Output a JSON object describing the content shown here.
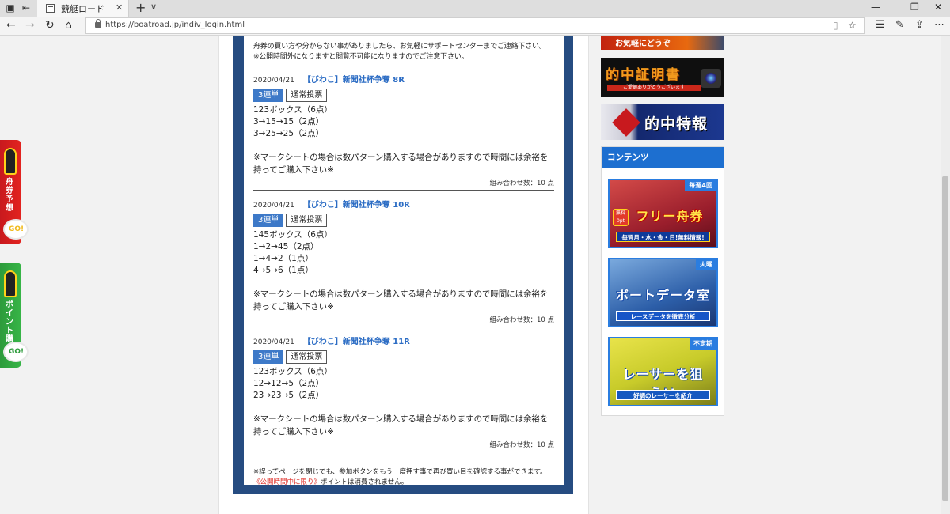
{
  "browser": {
    "tab_title": "競艇ロード",
    "url": "https://boatroad.jp/indiv_login.html",
    "icons": [
      "tabs-icon",
      "set-aside-icon",
      "favicon",
      "close-icon",
      "new-tab-icon",
      "chevron-down-icon",
      "minimize-icon",
      "maximize-icon",
      "window-close-icon",
      "back-icon",
      "forward-icon",
      "refresh-icon",
      "home-icon",
      "lock-icon",
      "reading-view-icon",
      "favorite-star-icon",
      "favorites-list-icon",
      "pen-icon",
      "share-icon",
      "more-icon"
    ]
  },
  "intro": {
    "line1": "舟券の買い方や分からない事がありましたら、お気軽にサポートセンターまでご連絡下さい。",
    "line2": "※公開時間外になりますと閲覧不可能になりますのでご注意下さい。"
  },
  "picks": [
    {
      "date": "2020/04/21",
      "title": "【びわこ】新聞社杯争奪 8R",
      "badge1": "3連単",
      "badge2": "通常投票",
      "lines": [
        "123ボックス（6点）",
        "3→15→15（2点）",
        "3→25→25（2点）"
      ],
      "note": "※マークシートの場合は数パターン購入する場合がありますので時間には余裕を持ってご購入下さい※",
      "count": "組み合わせ数：10 点"
    },
    {
      "date": "2020/04/21",
      "title": "【びわこ】新聞社杯争奪 10R",
      "badge1": "3連単",
      "badge2": "通常投票",
      "lines": [
        "145ボックス（6点）",
        "1→2→45（2点）",
        "1→4→2（1点）",
        "4→5→6（1点）"
      ],
      "note": "※マークシートの場合は数パターン購入する場合がありますので時間には余裕を持ってご購入下さい※",
      "count": "組み合わせ数：10 点"
    },
    {
      "date": "2020/04/21",
      "title": "【びわこ】新聞社杯争奪 11R",
      "badge1": "3連単",
      "badge2": "通常投票",
      "lines": [
        "123ボックス（6点）",
        "12→12→5（2点）",
        "23→23→5（2点）"
      ],
      "note": "※マークシートの場合は数パターン購入する場合がありますので時間には余裕を持ってご購入下さい※",
      "count": "組み合わせ数：10 点"
    }
  ],
  "footnote": {
    "line1": "※誤ってページを閉じでも、参加ボタンをもう一度押す事で再び買い目を確認する事ができます。",
    "red": "《公開時間中に限り》",
    "line2_rest": "ポイントは消費されません。"
  },
  "sidebar": {
    "top_banner": "お気軽にどうぞ",
    "tekichu_banner": {
      "title": "的中証明書",
      "sub": "ご愛顧ありがとうございます"
    },
    "hit_banner": "的中特報",
    "contents_title": "コンテンツ",
    "banners": [
      {
        "tag": "毎週4回",
        "free": "無料 0pt",
        "title": "フリー舟券",
        "sub": "毎週月・水・金・日!無料情報!"
      },
      {
        "tag": "火曜",
        "title": "ボートデータ室",
        "sub": "レースデータを徹底分析"
      },
      {
        "tag": "不定期",
        "title": "レーサーを狙え!!",
        "sub": "好調のレーサーを紹介"
      }
    ]
  },
  "left_tabs": [
    {
      "label": "舟券予想",
      "go": "GO!GO!"
    },
    {
      "label": "ポイント購入へ",
      "go": "GO!GO!"
    }
  ],
  "colors": {
    "frame_blue": "#264c81",
    "title_blue": "#2b6cc4",
    "badge_blue": "#3d79c8",
    "contents_head": "#1d6fd0",
    "red": "#e0302a"
  }
}
